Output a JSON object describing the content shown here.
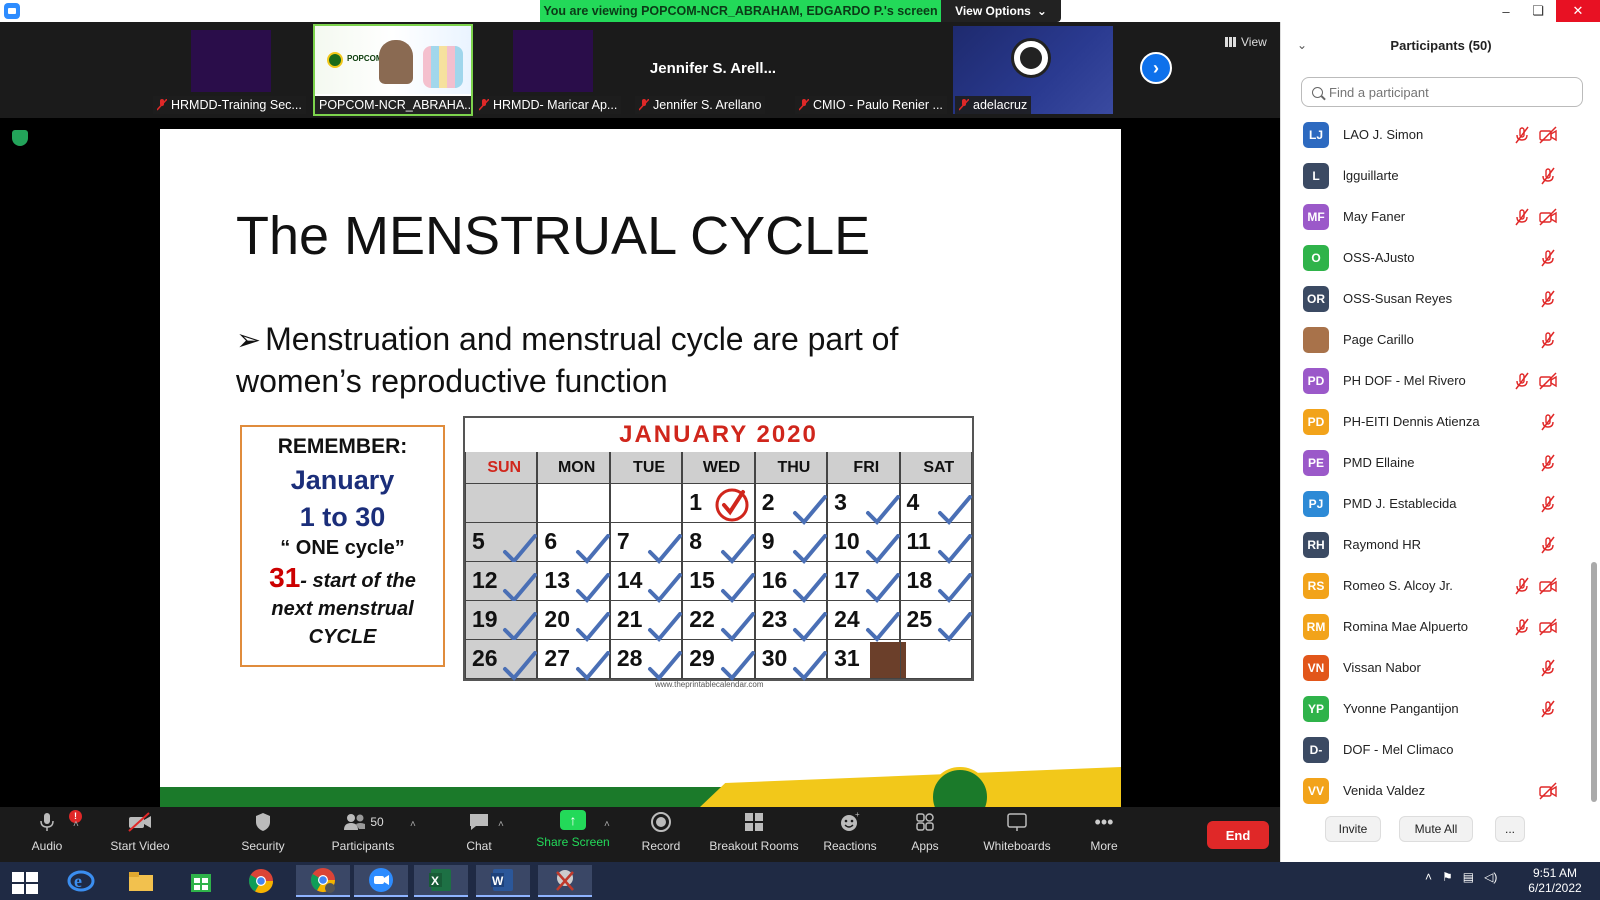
{
  "banner": {
    "viewing_text": "You are viewing POPCOM-NCR_ABRAHAM, EDGARDO P.'s screen",
    "view_options": "View Options"
  },
  "window_controls": {
    "minimize": "–",
    "restore": "❏",
    "close": "✕"
  },
  "video_strip": {
    "tiles": [
      {
        "name": "HRMDD-Training Sec..."
      },
      {
        "name": "POPCOM-NCR_ABRAHA...",
        "logo_text": "POPCOM"
      },
      {
        "name": "HRMDD- Maricar Ap..."
      },
      {
        "name": "Jennifer S. Arellano",
        "display_name": "Jennifer S. Arell..."
      },
      {
        "name": "CMIO - Paulo Renier ..."
      },
      {
        "name": "adelacruz"
      }
    ],
    "next_icon": "›",
    "view_label": "View"
  },
  "slide": {
    "title": "The MENSTRUAL CYCLE",
    "bullet_marker": "➢",
    "bullet_text": "Menstruation and menstrual cycle are part of women’s reproductive function",
    "remember": {
      "heading": "REMEMBER:",
      "month": "January",
      "range": "1 to 30",
      "cycle": "“ ONE cycle”",
      "start_num": "31",
      "start_text": "- start of the",
      "line2": "next menstrual",
      "line3": "CYCLE"
    },
    "calendar": {
      "title": "JANUARY 2020",
      "weekdays": [
        "SUN",
        "MON",
        "TUE",
        "WED",
        "THU",
        "FRI",
        "SAT"
      ],
      "weeks": [
        [
          "",
          "",
          "",
          "1",
          "2",
          "3",
          "4"
        ],
        [
          "5",
          "6",
          "7",
          "8",
          "9",
          "10",
          "11"
        ],
        [
          "12",
          "13",
          "14",
          "15",
          "16",
          "17",
          "18"
        ],
        [
          "19",
          "20",
          "21",
          "22",
          "23",
          "24",
          "25"
        ],
        [
          "26",
          "27",
          "28",
          "29",
          "30",
          "31",
          ""
        ]
      ],
      "url": "www.theprintablecalendar.com"
    }
  },
  "toolbar": {
    "audio": "Audio",
    "audio_badge": "!",
    "start_video": "Start Video",
    "security": "Security",
    "participants": "Participants",
    "participants_count": "50",
    "chat": "Chat",
    "share_screen": "Share Screen",
    "record": "Record",
    "breakout_rooms": "Breakout Rooms",
    "reactions": "Reactions",
    "apps": "Apps",
    "whiteboards": "Whiteboards",
    "more": "More",
    "end": "End",
    "caret": "˄"
  },
  "participants_panel": {
    "title": "Participants (50)",
    "collapse_icon": "⌄",
    "search_placeholder": "Find a participant",
    "participants": [
      {
        "initials": "LJ",
        "name": "LAO J. Simon",
        "color": "#2d6ac0",
        "muted": true,
        "video_off": true
      },
      {
        "initials": "L",
        "name": "lgguillarte",
        "color": "#3b4a63",
        "muted": true,
        "video_off": false
      },
      {
        "initials": "MF",
        "name": "May Faner",
        "color": "#9b59c9",
        "muted": true,
        "video_off": true
      },
      {
        "initials": "O",
        "name": "OSS-AJusto",
        "color": "#2fb34a",
        "muted": true,
        "video_off": false
      },
      {
        "initials": "OR",
        "name": "OSS-Susan Reyes",
        "color": "#3b4a63",
        "muted": true,
        "video_off": false
      },
      {
        "initials": "",
        "name": "Page Carillo",
        "color": "#a8724a",
        "muted": true,
        "video_off": false
      },
      {
        "initials": "PD",
        "name": "PH DOF - Mel Rivero",
        "color": "#9b59c9",
        "muted": true,
        "video_off": true
      },
      {
        "initials": "PD",
        "name": "PH-EITI Dennis Atienza",
        "color": "#f2a31a",
        "muted": true,
        "video_off": false
      },
      {
        "initials": "PE",
        "name": "PMD Ellaine",
        "color": "#9b59c9",
        "muted": true,
        "video_off": false
      },
      {
        "initials": "PJ",
        "name": "PMD J. Establecida",
        "color": "#2d8ad6",
        "muted": true,
        "video_off": false
      },
      {
        "initials": "RH",
        "name": "Raymond HR",
        "color": "#3b4a63",
        "muted": true,
        "video_off": false
      },
      {
        "initials": "RS",
        "name": "Romeo S. Alcoy Jr.",
        "color": "#f2a31a",
        "muted": true,
        "video_off": true
      },
      {
        "initials": "RM",
        "name": "Romina Mae Alpuerto",
        "color": "#f2a31a",
        "muted": true,
        "video_off": true
      },
      {
        "initials": "VN",
        "name": "Vissan Nabor",
        "color": "#e2561a",
        "muted": true,
        "video_off": false
      },
      {
        "initials": "YP",
        "name": "Yvonne Pangantijon",
        "color": "#2fb34a",
        "muted": true,
        "video_off": false
      },
      {
        "initials": "D-",
        "name": "DOF - Mel Climaco",
        "color": "#3b4a63",
        "muted": false,
        "video_off": false
      },
      {
        "initials": "VV",
        "name": "Venida Valdez",
        "color": "#f2a31a",
        "muted": false,
        "video_off": true
      }
    ],
    "footer": {
      "invite": "Invite",
      "mute_all": "Mute All",
      "more": "..."
    }
  },
  "taskbar": {
    "time": "9:51 AM",
    "date": "6/21/2022"
  }
}
